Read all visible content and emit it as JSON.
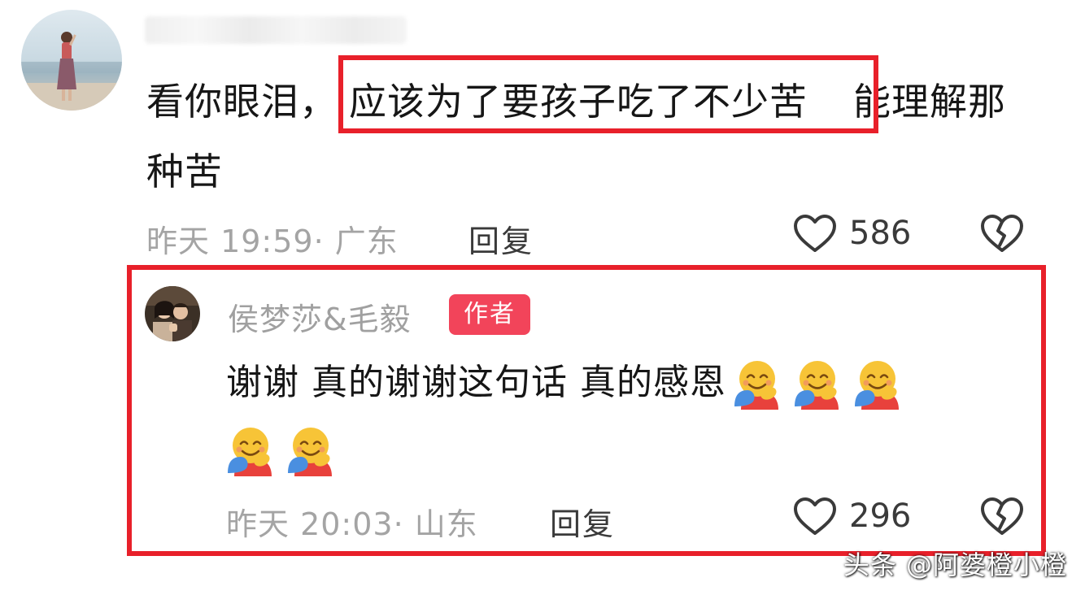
{
  "comment": {
    "username": "",
    "text_before": "看你眼泪，",
    "text_highlight": "应该为了要孩子吃了不少苦",
    "text_after": "能理解那种苦",
    "time_location": "昨天 19:59· 广东",
    "reply_label": "回复",
    "like_count": "586"
  },
  "reply": {
    "author_name": "侯梦莎&毛毅",
    "author_badge": "作者",
    "text": "谢谢 真的谢谢这句话 真的感恩",
    "emoji_name": "hugging-face-emoji",
    "emoji_count": 5,
    "time_location": "昨天 20:03· 山东",
    "reply_label": "回复",
    "like_count": "296"
  },
  "watermark": "头条 @阿婆橙小橙",
  "colors": {
    "highlight_border": "#e8202a",
    "badge_bg": "#f2445a",
    "meta_text": "#a4a4a4",
    "body_text": "#161616"
  },
  "icons": {
    "like": "heart-outline-icon",
    "dislike": "broken-heart-icon"
  }
}
